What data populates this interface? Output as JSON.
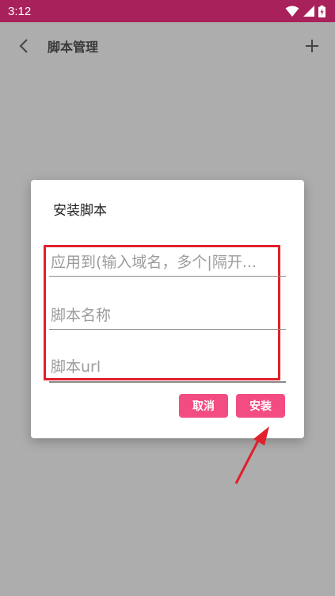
{
  "status_bar": {
    "time": "3:12",
    "icons": [
      "wifi-icon",
      "signal-icon",
      "battery-icon"
    ]
  },
  "app_bar": {
    "title": "脚本管理",
    "back_icon": "chevron-left-icon",
    "add_icon": "plus-icon"
  },
  "dialog": {
    "title": "安装脚本",
    "fields": [
      {
        "placeholder": "应用到(输入域名，多个|隔开...",
        "value": ""
      },
      {
        "placeholder": "脚本名称",
        "value": ""
      },
      {
        "placeholder": "脚本url",
        "value": ""
      }
    ],
    "cancel_label": "取消",
    "install_label": "安装"
  },
  "colors": {
    "status_bar": "#a8215a",
    "scrim": "#adadad",
    "button": "#f24c82",
    "highlight_box": "#e0202c"
  }
}
